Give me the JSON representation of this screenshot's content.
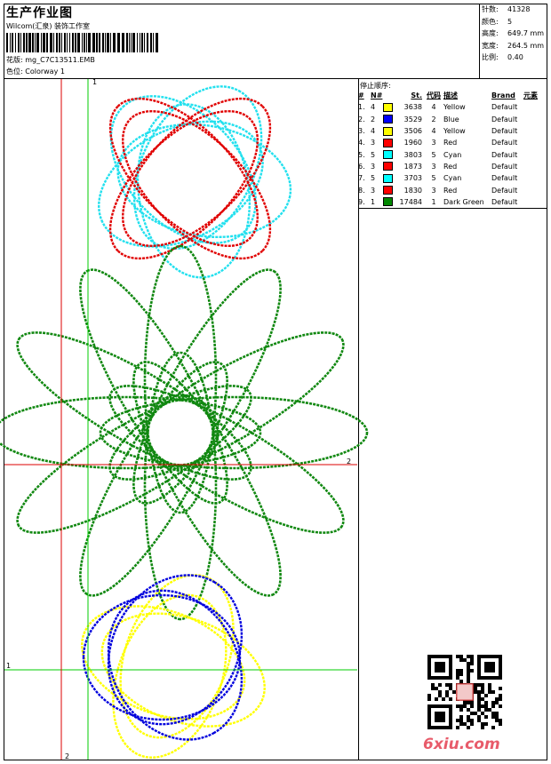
{
  "header": {
    "title": "生产作业图",
    "company": "Wilcom(汇泉) 装饰工作室",
    "pattern_label": "花版:",
    "pattern_value": "mg_C7C13511.EMB",
    "colorway_label": "色位:",
    "colorway_value": "Colorway 1"
  },
  "stats": [
    {
      "label": "针数:",
      "value": "41328"
    },
    {
      "label": "颜色:",
      "value": "5"
    },
    {
      "label": "高度:",
      "value": "649.7 mm"
    },
    {
      "label": "宽度:",
      "value": "264.5 mm"
    },
    {
      "label": "比例:",
      "value": "0.40"
    }
  ],
  "stop_sequence": {
    "heading": "停止顺序:",
    "columns": [
      "#",
      "N#",
      "St.",
      "代码",
      "描述",
      "Brand",
      "元素"
    ],
    "rows": [
      {
        "num": "1.",
        "n": "4",
        "color": "#ffff00",
        "st": "3638",
        "code": "4",
        "desc": "Yellow",
        "brand": "Default"
      },
      {
        "num": "2.",
        "n": "2",
        "color": "#0000ff",
        "st": "3529",
        "code": "2",
        "desc": "Blue",
        "brand": "Default"
      },
      {
        "num": "3.",
        "n": "4",
        "color": "#ffff00",
        "st": "3506",
        "code": "4",
        "desc": "Yellow",
        "brand": "Default"
      },
      {
        "num": "4.",
        "n": "3",
        "color": "#ff0000",
        "st": "1960",
        "code": "3",
        "desc": "Red",
        "brand": "Default"
      },
      {
        "num": "5.",
        "n": "5",
        "color": "#00ffff",
        "st": "3803",
        "code": "5",
        "desc": "Cyan",
        "brand": "Default"
      },
      {
        "num": "6.",
        "n": "3",
        "color": "#ff0000",
        "st": "1873",
        "code": "3",
        "desc": "Red",
        "brand": "Default"
      },
      {
        "num": "7.",
        "n": "5",
        "color": "#00ffff",
        "st": "3703",
        "code": "5",
        "desc": "Cyan",
        "brand": "Default"
      },
      {
        "num": "8.",
        "n": "3",
        "color": "#ff0000",
        "st": "1830",
        "code": "3",
        "desc": "Red",
        "brand": "Default"
      },
      {
        "num": "9.",
        "n": "1",
        "color": "#008800",
        "st": "17484",
        "code": "1",
        "desc": "Dark Green",
        "brand": "Default"
      }
    ]
  },
  "design_axes": {
    "green_label_top": "1",
    "green_label_left": "1",
    "red_label_right": "2",
    "red_label_bottom": "2",
    "axis_colors": {
      "green": "#00cc00",
      "red": "#dd0000"
    }
  },
  "watermark": "6xiu.com",
  "design_colors": {
    "cyan": "#22e0ee",
    "red": "#e00000",
    "green": "#118811",
    "yellow": "#ffff00",
    "blue": "#0000dd"
  }
}
